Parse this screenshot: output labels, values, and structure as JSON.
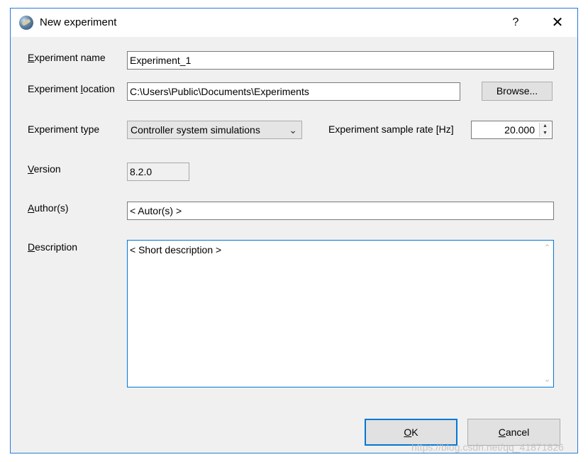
{
  "window": {
    "title": "New experiment",
    "help_label": "?",
    "close_label": "✕",
    "icon": "globe-icon"
  },
  "form": {
    "name": {
      "label_ul": "E",
      "label_rest": "xperiment name",
      "value": "Experiment_1"
    },
    "location": {
      "label_pre": "Experiment ",
      "label_ul": "l",
      "label_rest": "ocation",
      "value": "C:\\Users\\Public\\Documents\\Experiments",
      "browse_label": "Browse..."
    },
    "type": {
      "label": "Experiment type",
      "selected": "Controller system simulations"
    },
    "sample_rate": {
      "label": "Experiment sample rate [Hz]",
      "value": "20.000"
    },
    "version": {
      "label_ul": "V",
      "label_rest": "ersion",
      "value": "8.2.0"
    },
    "authors": {
      "label_ul": "A",
      "label_rest": "uthor(s)",
      "value": "< Autor(s) >"
    },
    "description": {
      "label_ul": "D",
      "label_rest": "escription",
      "value": "< Short description >"
    }
  },
  "buttons": {
    "ok_ul": "O",
    "ok_rest": "K",
    "cancel_ul": "C",
    "cancel_rest": "ancel"
  },
  "watermark": "https://blog.csdn.net/qq_41871826"
}
